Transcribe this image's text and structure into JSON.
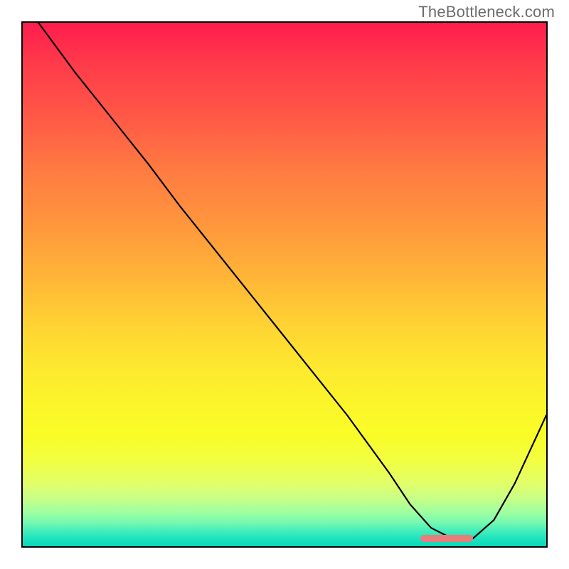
{
  "watermark": "TheBottleneck.com",
  "chart_data": {
    "type": "line",
    "title": "",
    "xlabel": "",
    "ylabel": "",
    "xlim": [
      0,
      100
    ],
    "ylim": [
      0,
      100
    ],
    "grid": false,
    "legend": false,
    "series": [
      {
        "name": "bottleneck-curve",
        "x": [
          3,
          10,
          18,
          24,
          30,
          38,
          46,
          54,
          62,
          70,
          74,
          78,
          82,
          86,
          90,
          94,
          100
        ],
        "y": [
          100,
          90.5,
          80.5,
          73,
          65,
          55,
          45,
          35,
          25,
          14,
          8,
          3.5,
          1.5,
          1.5,
          5,
          12,
          25
        ]
      }
    ],
    "marker": {
      "x_start": 76,
      "x_end": 86,
      "y": 1.5,
      "color": "#e87d7c"
    },
    "background_gradient": {
      "top": "#ff1d4d",
      "bottom": "#07d8ba"
    }
  }
}
